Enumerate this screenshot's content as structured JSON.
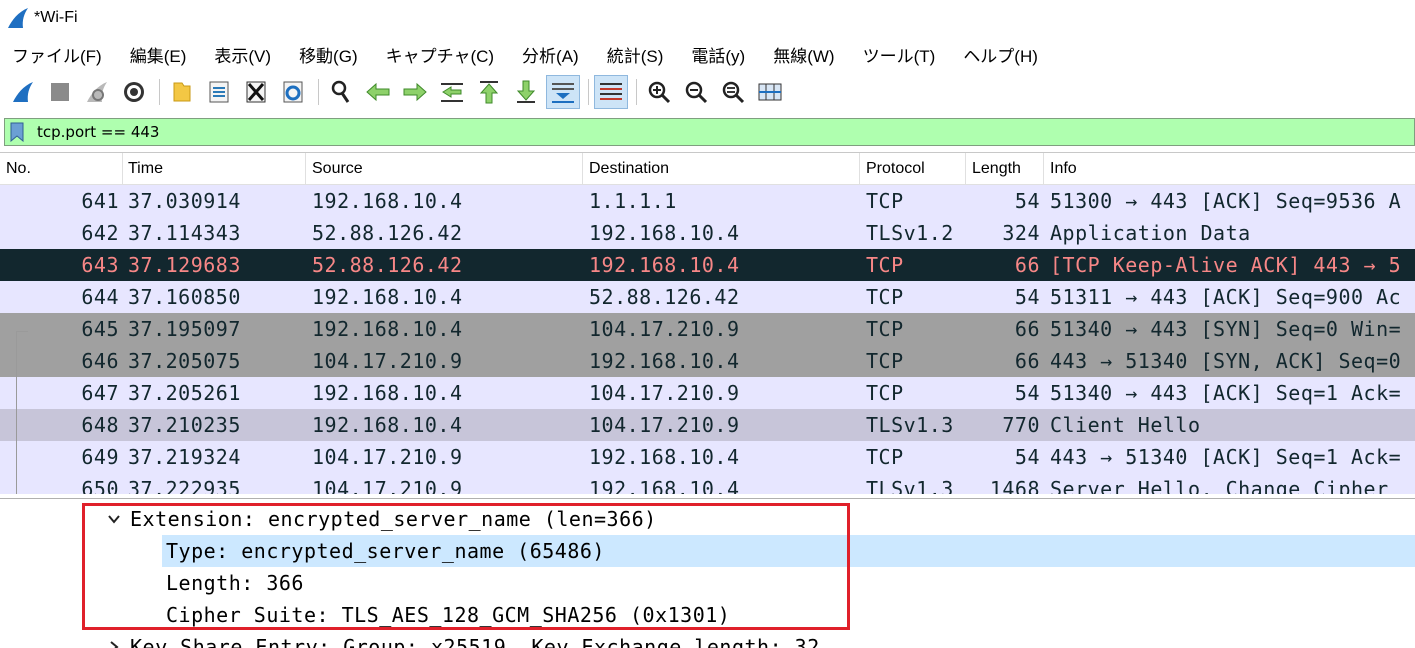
{
  "window": {
    "title": "*Wi-Fi"
  },
  "menu": [
    "ファイル(F)",
    "編集(E)",
    "表示(V)",
    "移動(G)",
    "キャプチャ(C)",
    "分析(A)",
    "統計(S)",
    "電話(y)",
    "無線(W)",
    "ツール(T)",
    "ヘルプ(H)"
  ],
  "toolbar": {
    "icons": [
      "shark-fin-start-icon",
      "stop-square-icon",
      "restart-fin-icon",
      "capture-options-gear-icon",
      "open-folder-icon",
      "save-file-icon",
      "close-file-icon",
      "reload-icon",
      "find-packet-icon",
      "go-back-icon",
      "go-forward-icon",
      "go-to-packet-icon",
      "first-packet-icon",
      "last-packet-icon",
      "autoscroll-icon",
      "colorize-icon",
      "zoom-in-icon",
      "zoom-out-icon",
      "normal-size-icon",
      "resize-columns-icon"
    ]
  },
  "filter": {
    "value": "tcp.port == 443",
    "background": "#afffaf"
  },
  "packet_list": {
    "columns": [
      "No.",
      "Time",
      "Source",
      "Destination",
      "Protocol",
      "Length",
      "Info"
    ],
    "rows": [
      {
        "no": "641",
        "time": "37.030914",
        "src": "192.168.10.4",
        "dst": "1.1.1.1",
        "proto": "TCP",
        "len": "54",
        "info": "51300 → 443 [ACK] Seq=9536 A",
        "bg": "#e7e6ff",
        "fg": "#12272e"
      },
      {
        "no": "642",
        "time": "37.114343",
        "src": "52.88.126.42",
        "dst": "192.168.10.4",
        "proto": "TLSv1.2",
        "len": "324",
        "info": "Application Data",
        "bg": "#e7e6ff",
        "fg": "#12272e"
      },
      {
        "no": "643",
        "time": "37.129683",
        "src": "52.88.126.42",
        "dst": "192.168.10.4",
        "proto": "TCP",
        "len": "66",
        "info": "[TCP Keep-Alive ACK] 443 → 5",
        "bg": "#12272e",
        "fg": "#f78787"
      },
      {
        "no": "644",
        "time": "37.160850",
        "src": "192.168.10.4",
        "dst": "52.88.126.42",
        "proto": "TCP",
        "len": "54",
        "info": "51311 → 443 [ACK] Seq=900 Ac",
        "bg": "#e7e6ff",
        "fg": "#12272e"
      },
      {
        "no": "645",
        "time": "37.195097",
        "src": "192.168.10.4",
        "dst": "104.17.210.9",
        "proto": "TCP",
        "len": "66",
        "info": "51340 → 443 [SYN] Seq=0 Win=",
        "bg": "#a0a0a0",
        "fg": "#12272e"
      },
      {
        "no": "646",
        "time": "37.205075",
        "src": "104.17.210.9",
        "dst": "192.168.10.4",
        "proto": "TCP",
        "len": "66",
        "info": "443 → 51340 [SYN, ACK] Seq=0",
        "bg": "#a0a0a0",
        "fg": "#12272e"
      },
      {
        "no": "647",
        "time": "37.205261",
        "src": "192.168.10.4",
        "dst": "104.17.210.9",
        "proto": "TCP",
        "len": "54",
        "info": "51340 → 443 [ACK] Seq=1 Ack=",
        "bg": "#e7e6ff",
        "fg": "#12272e"
      },
      {
        "no": "648",
        "time": "37.210235",
        "src": "192.168.10.4",
        "dst": "104.17.210.9",
        "proto": "TLSv1.3",
        "len": "770",
        "info": "Client Hello",
        "bg": "#c7c5d9",
        "fg": "#12272e"
      },
      {
        "no": "649",
        "time": "37.219324",
        "src": "104.17.210.9",
        "dst": "192.168.10.4",
        "proto": "TCP",
        "len": "54",
        "info": "443 → 51340 [ACK] Seq=1 Ack=",
        "bg": "#e7e6ff",
        "fg": "#12272e"
      },
      {
        "no": "650",
        "time": "37.222935",
        "src": "104.17.210.9",
        "dst": "192.168.10.4",
        "proto": "TLSv1.3",
        "len": "1468",
        "info": "Server Hello, Change Cipher",
        "bg": "#e7e6ff",
        "fg": "#12272e"
      }
    ]
  },
  "details": {
    "rows": [
      {
        "text": "Extension: encrypted_server_name (len=366)",
        "indent": 1,
        "expander": "expanded",
        "selected": false
      },
      {
        "text": "Type: encrypted_server_name (65486)",
        "indent": 2,
        "expander": "none",
        "selected": true
      },
      {
        "text": "Length: 366",
        "indent": 2,
        "expander": "none",
        "selected": false
      },
      {
        "text": "Cipher Suite: TLS_AES_128_GCM_SHA256 (0x1301)",
        "indent": 2,
        "expander": "none",
        "selected": false
      },
      {
        "text": "Key Share Entry: Group: x25519, Key Exchange length: 32",
        "indent": 1,
        "expander": "collapsed",
        "selected": false
      }
    ],
    "highlight_color": "#e0202a",
    "selected_color": "#cce8ff"
  }
}
